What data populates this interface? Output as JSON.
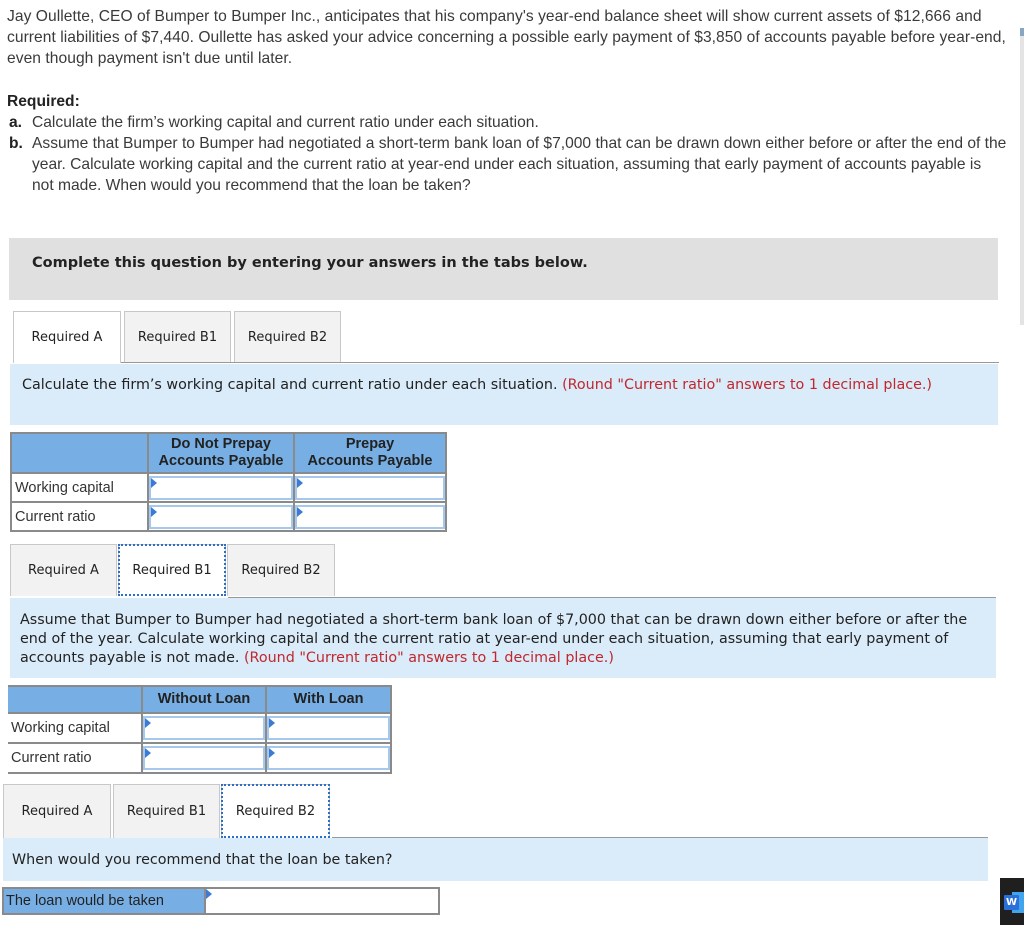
{
  "intro": {
    "paragraph": "Jay Oullette, CEO of Bumper to Bumper Inc., anticipates that his company's year-end balance sheet will show current assets of $12,666 and current liabilities of $7,440. Oullette has asked your advice concerning a possible early payment of $3,850 of accounts payable before year-end, even though payment isn't due until later."
  },
  "required": {
    "title": "Required:",
    "items": [
      {
        "letter": "a.",
        "text": "Calculate the firm’s working capital and current ratio under each situation."
      },
      {
        "letter": "b.",
        "text": "Assume that Bumper to Bumper had negotiated a short-term bank loan of $7,000 that can be drawn down either before or after the end of the year. Calculate working capital and the current ratio at year-end under each situation, assuming that early payment of accounts payable is not made. When would you recommend that the loan be taken?"
      }
    ]
  },
  "banner": {
    "text": "Complete this question by entering your answers in the tabs below."
  },
  "tabs": [
    "Required A",
    "Required B1",
    "Required B2"
  ],
  "section_a": {
    "active_tab": "Required A",
    "instruction": "Calculate the firm’s working capital and current ratio under each situation.",
    "note": "(Round \"Current ratio\" answers to 1 decimal place.)",
    "columns": [
      "Do Not Prepay Accounts Payable",
      "Prepay Accounts Payable"
    ],
    "columns_line1": [
      "Do Not Prepay",
      "Prepay"
    ],
    "columns_line2": [
      "Accounts Payable",
      "Accounts Payable"
    ],
    "rows": [
      {
        "label": "Working capital",
        "values": [
          "",
          ""
        ]
      },
      {
        "label": "Current ratio",
        "values": [
          "",
          ""
        ]
      }
    ]
  },
  "section_b1": {
    "active_tab": "Required B1",
    "instruction": "Assume that Bumper to Bumper had negotiated a short-term bank loan of $7,000 that can be drawn down either before or after the end of the year. Calculate working capital and the current ratio at year-end under each situation, assuming that early payment of accounts payable is not made.",
    "note": "(Round \"Current ratio\" answers to 1 decimal place.)",
    "columns": [
      "Without Loan",
      "With Loan"
    ],
    "rows": [
      {
        "label": "Working capital",
        "values": [
          "",
          ""
        ]
      },
      {
        "label": "Current ratio",
        "values": [
          "",
          ""
        ]
      }
    ]
  },
  "section_b2": {
    "active_tab": "Required B2",
    "instruction": "When would you recommend that the loan be taken?",
    "label": "The loan would be taken",
    "value": ""
  },
  "taskbar": {
    "app_icon": "word-icon",
    "app_letter": "W"
  },
  "colors": {
    "header_blue": "#77aee3",
    "instruction_bg": "#daebf9",
    "note_red": "#c1272d",
    "banner_gray": "#e0e0e0"
  }
}
